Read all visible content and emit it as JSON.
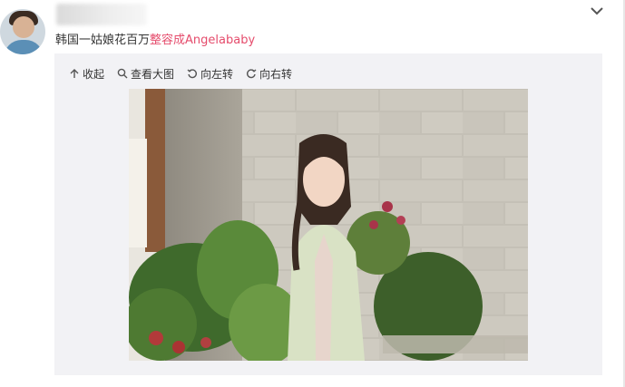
{
  "post": {
    "text_prefix": "韩国一姑娘花百万",
    "text_tag": "整容成Angelababy"
  },
  "toolbar": {
    "collapse_label": "收起",
    "view_large_label": "查看大图",
    "rotate_left_label": "向左转",
    "rotate_right_label": "向右转"
  },
  "icons": {
    "collapse": "arrow-up-icon",
    "view_large": "magnifier-icon",
    "rotate_left": "rotate-left-icon",
    "rotate_right": "rotate-right-icon",
    "menu": "chevron-down-icon"
  },
  "colors": {
    "tag_text": "#e54c6c",
    "panel_bg": "#f2f2f5",
    "text": "#333333"
  }
}
